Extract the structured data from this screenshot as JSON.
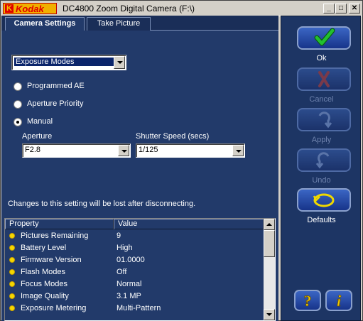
{
  "window": {
    "brand": "Kodak",
    "brand_mark": "K",
    "title": "DC4800 Zoom Digital Camera (F:\\)",
    "controls": {
      "minimize": "_",
      "maximize": "□",
      "close": "✕"
    }
  },
  "tabs": [
    {
      "label": "Camera Settings",
      "active": true
    },
    {
      "label": "Take Picture",
      "active": false
    }
  ],
  "settings": {
    "mode_select": {
      "value": "Exposure Modes"
    },
    "radio_options": [
      {
        "label": "Programmed AE",
        "selected": false
      },
      {
        "label": "Aperture Priority",
        "selected": false
      },
      {
        "label": "Manual",
        "selected": true
      }
    ],
    "aperture": {
      "label": "Aperture",
      "value": "F2.8"
    },
    "shutter": {
      "label": "Shutter Speed (secs)",
      "value": "1/125"
    },
    "notice": "Changes to this setting will be lost after disconnecting."
  },
  "properties": {
    "columns": [
      "Property",
      "Value"
    ],
    "rows": [
      {
        "name": "Pictures Remaining",
        "value": "9"
      },
      {
        "name": "Battery Level",
        "value": "High"
      },
      {
        "name": "Firmware Version",
        "value": "01.0000"
      },
      {
        "name": "Flash Modes",
        "value": "Off"
      },
      {
        "name": "Focus Modes",
        "value": "Normal"
      },
      {
        "name": "Image Quality",
        "value": "3.1 MP"
      },
      {
        "name": "Exposure Metering",
        "value": "Multi-Pattern"
      }
    ]
  },
  "actions": {
    "ok": {
      "label": "Ok",
      "enabled": true
    },
    "cancel": {
      "label": "Cancel",
      "enabled": false
    },
    "apply": {
      "label": "Apply",
      "enabled": false
    },
    "undo": {
      "label": "Undo",
      "enabled": false
    },
    "defaults": {
      "label": "Defaults",
      "enabled": true
    },
    "help": {
      "icon": "question-mark-icon"
    },
    "info": {
      "icon": "info-icon"
    }
  },
  "colors": {
    "panel_bg": "#223a6a",
    "action_panel_bg": "#1d3564",
    "ok_check": "#22c030",
    "cancel_x": "#c0302c",
    "bullet": "#f5d800",
    "help_yellow": "#f0c800"
  }
}
